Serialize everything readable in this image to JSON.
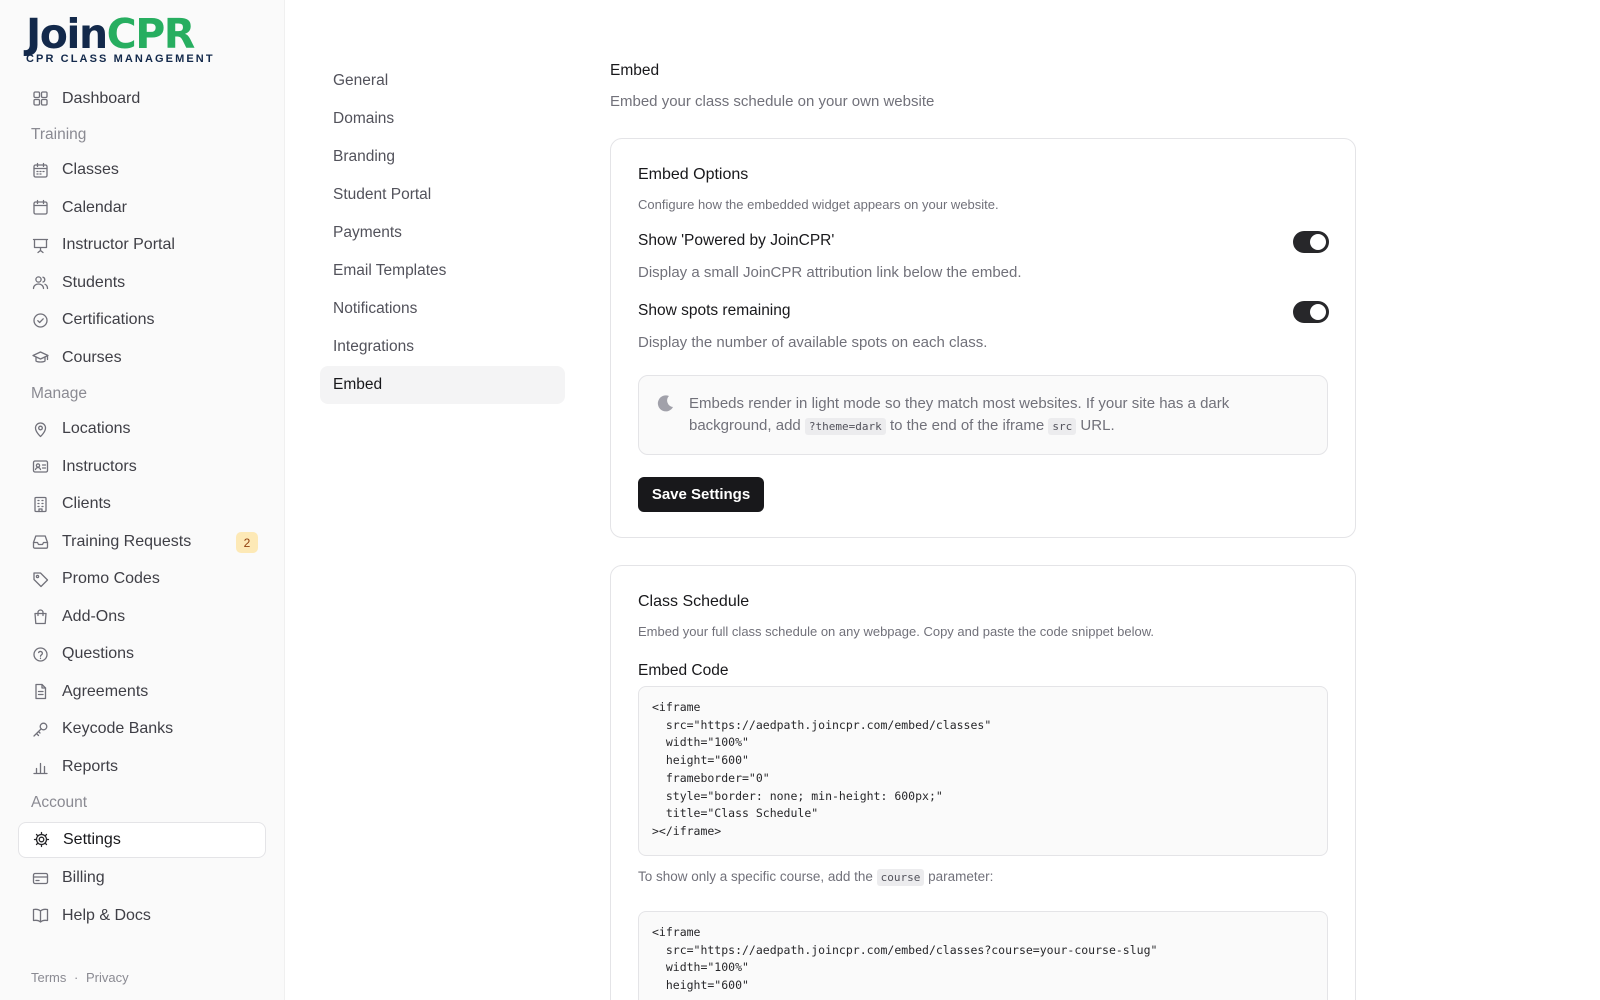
{
  "brand": {
    "name_part1": "Join",
    "name_part2": "CPR",
    "tagline": "CPR CLASS MANAGEMENT",
    "colors": {
      "navy": "#13294b",
      "green": "#27ae60"
    }
  },
  "sidebar": {
    "items": [
      {
        "type": "item",
        "label": "Dashboard",
        "icon": "grid-icon"
      },
      {
        "type": "section",
        "label": "Training"
      },
      {
        "type": "item",
        "label": "Classes",
        "icon": "calendar-days-icon"
      },
      {
        "type": "item",
        "label": "Calendar",
        "icon": "calendar-icon"
      },
      {
        "type": "item",
        "label": "Instructor Portal",
        "icon": "presentation-icon"
      },
      {
        "type": "item",
        "label": "Students",
        "icon": "users-icon"
      },
      {
        "type": "item",
        "label": "Certifications",
        "icon": "check-circle-icon"
      },
      {
        "type": "item",
        "label": "Courses",
        "icon": "graduation-cap-icon"
      },
      {
        "type": "section",
        "label": "Manage"
      },
      {
        "type": "item",
        "label": "Locations",
        "icon": "map-pin-icon"
      },
      {
        "type": "item",
        "label": "Instructors",
        "icon": "id-card-icon"
      },
      {
        "type": "item",
        "label": "Clients",
        "icon": "building-icon"
      },
      {
        "type": "item",
        "label": "Training Requests",
        "icon": "inbox-icon",
        "badge": "2"
      },
      {
        "type": "item",
        "label": "Promo Codes",
        "icon": "tag-icon"
      },
      {
        "type": "item",
        "label": "Add-Ons",
        "icon": "shopping-bag-icon"
      },
      {
        "type": "item",
        "label": "Questions",
        "icon": "help-circle-icon"
      },
      {
        "type": "item",
        "label": "Agreements",
        "icon": "file-text-icon"
      },
      {
        "type": "item",
        "label": "Keycode Banks",
        "icon": "key-icon"
      },
      {
        "type": "item",
        "label": "Reports",
        "icon": "bar-chart-icon"
      },
      {
        "type": "section",
        "label": "Account"
      },
      {
        "type": "item",
        "label": "Settings",
        "icon": "gear-icon",
        "active": true
      },
      {
        "type": "item",
        "label": "Billing",
        "icon": "credit-card-icon"
      },
      {
        "type": "item",
        "label": "Help & Docs",
        "icon": "book-icon"
      }
    ],
    "footer": {
      "terms": "Terms",
      "separator": "·",
      "privacy": "Privacy"
    }
  },
  "settings_nav": {
    "items": [
      "General",
      "Domains",
      "Branding",
      "Student Portal",
      "Payments",
      "Email Templates",
      "Notifications",
      "Integrations",
      "Embed"
    ],
    "active": "Embed"
  },
  "main": {
    "title": "Embed",
    "description": "Embed your class schedule on your own website",
    "embed_options": {
      "title": "Embed Options",
      "description": "Configure how the embedded widget appears on your website.",
      "options": [
        {
          "label": "Show 'Powered by JoinCPR'",
          "description": "Display a small JoinCPR attribution link below the embed.",
          "enabled": true
        },
        {
          "label": "Show spots remaining",
          "description": "Display the number of available spots on each class.",
          "enabled": true
        }
      ],
      "note": {
        "icon": "moon-icon",
        "text_1": "Embeds render in light mode so they match most websites. If your site has a dark background, add ",
        "code_1": "?theme=dark",
        "text_2": " to the end of the iframe ",
        "code_2": "src",
        "text_3": " URL."
      },
      "save_label": "Save Settings"
    },
    "class_schedule": {
      "title": "Class Schedule",
      "description": "Embed your full class schedule on any webpage. Copy and paste the code snippet below.",
      "code_label": "Embed Code",
      "code": "<iframe\n  src=\"https://aedpath.joincpr.com/embed/classes\"\n  width=\"100%\"\n  height=\"600\"\n  frameborder=\"0\"\n  style=\"border: none; min-height: 600px;\"\n  title=\"Class Schedule\"\n></iframe>",
      "course_note_1": "To show only a specific course, add the ",
      "course_note_code": "course",
      "course_note_2": " parameter:",
      "code_course": "<iframe\n  src=\"https://aedpath.joincpr.com/embed/classes?course=your-course-slug\"\n  width=\"100%\"\n  height=\"600\""
    }
  }
}
